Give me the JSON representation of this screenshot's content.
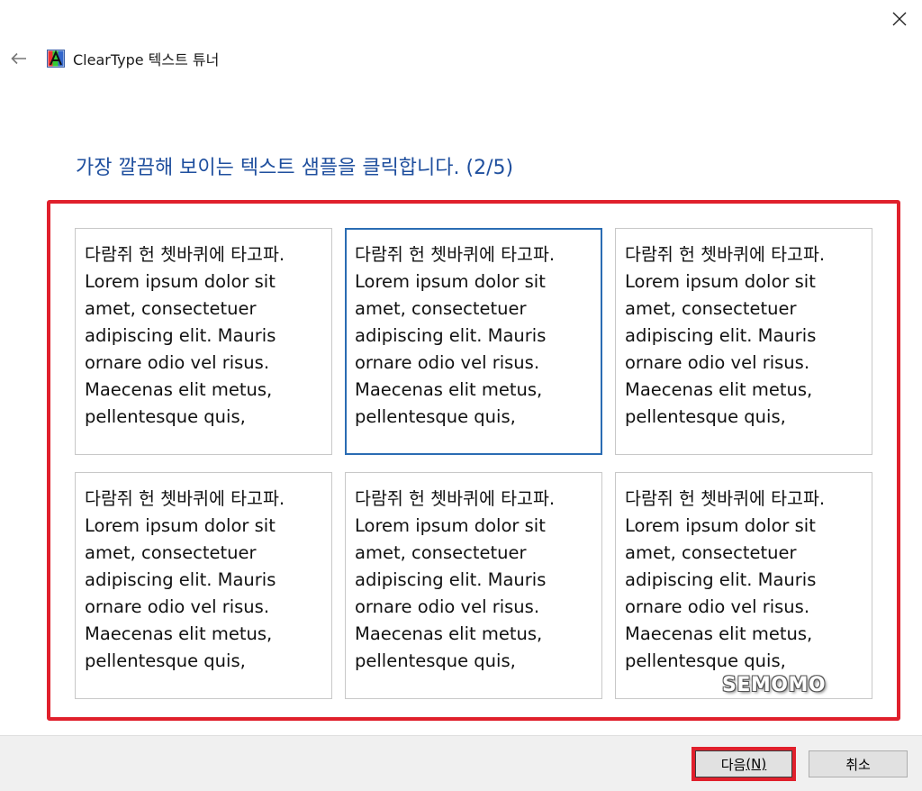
{
  "window": {
    "title": "ClearType 텍스트 튜너",
    "app_icon": "cleartype-icon",
    "back_icon": "back-arrow-icon",
    "close_icon": "close-icon"
  },
  "instruction": "가장 깔끔해 보이는 텍스트 샘플을 클릭합니다. (2/5)",
  "samples": [
    {
      "text": "다람쥐 헌 쳇바퀴에 타고파. Lorem ipsum dolor sit amet, consectetuer adipiscing elit. Mauris ornare odio vel risus. Maecenas elit metus, pellentesque quis,"
    },
    {
      "text": "다람쥐 헌 쳇바퀴에 타고파. Lorem ipsum dolor sit amet, consectetuer adipiscing elit. Mauris ornare odio vel risus. Maecenas elit metus, pellentesque quis,"
    },
    {
      "text": "다람쥐 헌 쳇바퀴에 타고파. Lorem ipsum dolor sit amet, consectetuer adipiscing elit. Mauris ornare odio vel risus. Maecenas elit metus, pellentesque quis,"
    },
    {
      "text": "다람쥐 헌 쳇바퀴에 타고파. Lorem ipsum dolor sit amet, consectetuer adipiscing elit. Mauris ornare odio vel risus. Maecenas elit metus, pellentesque quis,"
    },
    {
      "text": "다람쥐 헌 쳇바퀴에 타고파. Lorem ipsum dolor sit amet, consectetuer adipiscing elit. Mauris ornare odio vel risus. Maecenas elit metus, pellentesque quis,"
    },
    {
      "text": "다람쥐 헌 쳇바퀴에 타고파. Lorem ipsum dolor sit amet, consectetuer adipiscing elit. Mauris ornare odio vel risus. Maecenas elit metus, pellentesque quis,"
    }
  ],
  "selected_sample": 2,
  "watermark": "SEMOMO",
  "buttons": {
    "next_label": "다음",
    "next_mnemonic": "(N)",
    "cancel_label": "취소"
  },
  "colors": {
    "instruction": "#1f4f9e",
    "highlight": "#e0202c",
    "selected_border": "#2a6cb3"
  }
}
